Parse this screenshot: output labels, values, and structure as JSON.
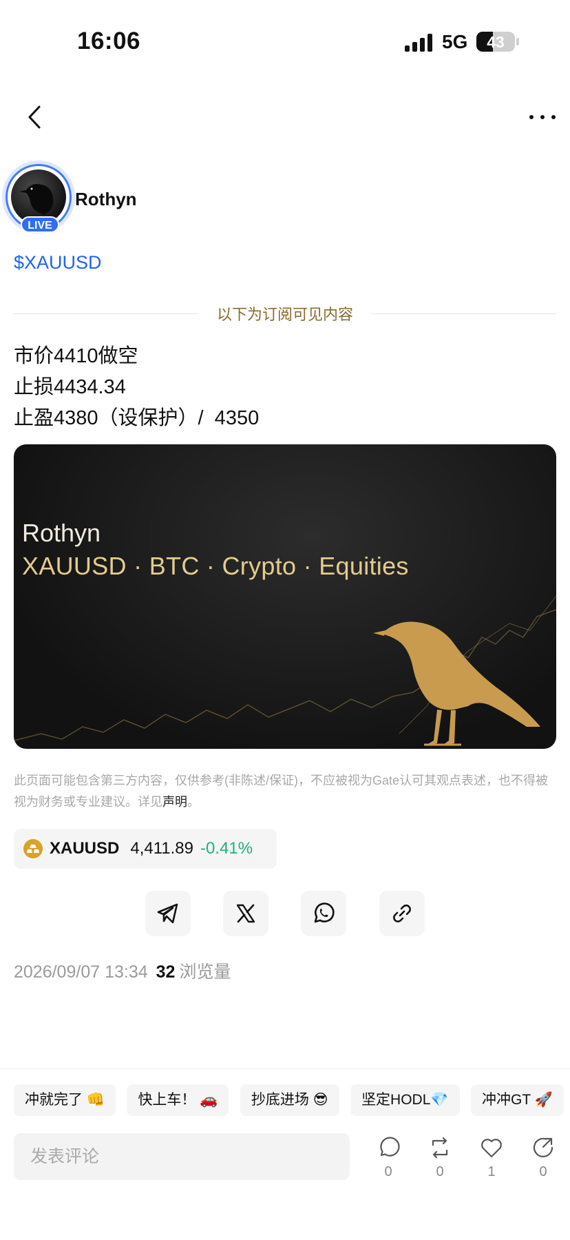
{
  "status_bar": {
    "time": "16:06",
    "network": "5G",
    "battery": "43",
    "battery_level_percent": 43
  },
  "nav": {
    "back_icon": "chevron-left-icon",
    "more_icon": "more-horizontal-icon"
  },
  "author": {
    "name": "Rothyn",
    "live_label": "LIVE"
  },
  "post": {
    "ticker_tag": "$XAUUSD",
    "subscriber_divider": "以下为订阅可见内容",
    "lines": [
      "市价4410做空",
      "止损4434.34",
      "止盈4380（设保护）/  4350"
    ]
  },
  "banner": {
    "brand": "Rothyn",
    "tagline": "XAUUSD · BTC · Crypto · Equities"
  },
  "disclaimer": {
    "text": "此页面可能包含第三方内容，仅供参考(非陈述/保证)，不应被视为Gate认可其观点表述，也不得被视为财务或专业建议。详见",
    "link": "声明",
    "end": "。"
  },
  "quote": {
    "symbol": "XAUUSD",
    "price": "4,411.89",
    "change": "-0.41%",
    "change_color": "#21b07a"
  },
  "share": [
    "telegram-icon",
    "x-icon",
    "whatsapp-icon",
    "link-icon"
  ],
  "meta": {
    "datetime": "2026/09/07 13:34",
    "views_count": "32",
    "views_label": "浏览量"
  },
  "reactions": [
    "冲就完了 👊",
    "快上车！ 🚗",
    "抄底进场 😎",
    "坚定HODL💎",
    "冲冲GT 🚀"
  ],
  "comment": {
    "placeholder": "发表评论"
  },
  "actions": {
    "comment": "0",
    "repost": "0",
    "like": "1",
    "share": "0"
  },
  "colors": {
    "accent_blue": "#1f63f5",
    "gold": "#e5cb8e",
    "positive_green": "#21b07a"
  }
}
